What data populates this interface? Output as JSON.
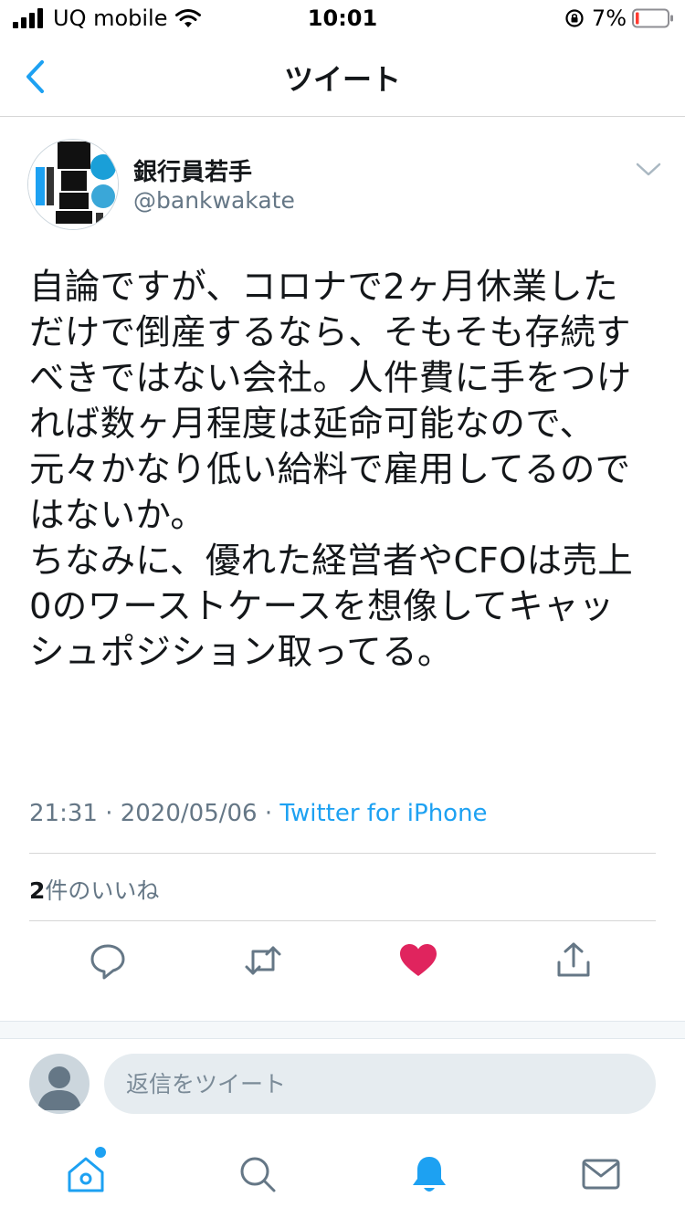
{
  "status_bar": {
    "carrier": "UQ mobile",
    "time": "10:01",
    "battery": "7%"
  },
  "nav": {
    "title": "ツイート"
  },
  "tweet": {
    "author_name": "銀行員若手",
    "author_handle": "@bankwakate",
    "text_lines": [
      "自論ですが、コロナで2ヶ月休業した",
      "だけで倒産するなら、そもそも存続す",
      "べきではない会社。人件費に手をつけ",
      "れば数ヶ月程度は延命可能なので、",
      "元々かなり低い給料で雇用してるので",
      "はないか。",
      "ちなみに、優れた経営者やCFOは売上",
      "0のワーストケースを想像してキャッ",
      "シュポジション取ってる。"
    ],
    "timestamp": "21:31 · 2020/05/06 · ",
    "source": "Twitter for iPhone",
    "likes_count": "2",
    "likes_label": "件のいいね"
  },
  "reply": {
    "placeholder": "返信をツイート"
  },
  "colors": {
    "accent": "#1da1f2",
    "like": "#e0245e",
    "secondary_text": "#657786",
    "battery_low": "#ff3b30"
  },
  "icons": {
    "back": "chevron-left-icon",
    "more": "chevron-down-icon",
    "reply": "reply-icon",
    "retweet": "retweet-icon",
    "like": "heart-icon",
    "share": "share-icon",
    "home": "home-icon",
    "search": "search-icon",
    "notifications": "bell-icon",
    "messages": "mail-icon"
  }
}
